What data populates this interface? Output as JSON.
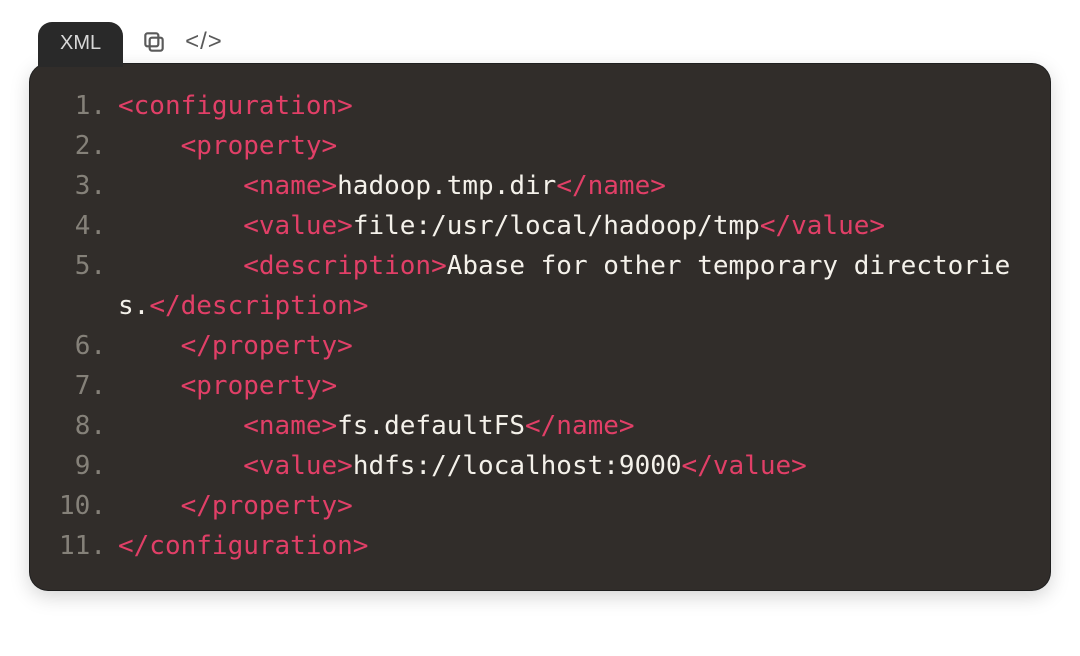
{
  "tab": {
    "label": "XML"
  },
  "icons": {
    "copy": "copy-icon",
    "code": "</>"
  },
  "lines": [
    {
      "n": "1.",
      "segs": [
        {
          "c": "tag",
          "t": "<configuration>"
        }
      ]
    },
    {
      "n": "2.",
      "segs": [
        {
          "c": "txt",
          "t": "    "
        },
        {
          "c": "tag",
          "t": "<property>"
        }
      ]
    },
    {
      "n": "3.",
      "segs": [
        {
          "c": "txt",
          "t": "        "
        },
        {
          "c": "tag",
          "t": "<name>"
        },
        {
          "c": "txt",
          "t": "hadoop.tmp.dir"
        },
        {
          "c": "tag",
          "t": "</name>"
        }
      ]
    },
    {
      "n": "4.",
      "segs": [
        {
          "c": "txt",
          "t": "        "
        },
        {
          "c": "tag",
          "t": "<value>"
        },
        {
          "c": "txt",
          "t": "file:/usr/local/hadoop/tmp"
        },
        {
          "c": "tag",
          "t": "</value>"
        }
      ]
    },
    {
      "n": "5.",
      "segs": [
        {
          "c": "txt",
          "t": "        "
        },
        {
          "c": "tag",
          "t": "<description>"
        },
        {
          "c": "txt",
          "t": "Abase for other temporary directories."
        },
        {
          "c": "tag",
          "t": "</description>"
        }
      ]
    },
    {
      "n": "6.",
      "segs": [
        {
          "c": "txt",
          "t": "    "
        },
        {
          "c": "tag",
          "t": "</property>"
        }
      ]
    },
    {
      "n": "7.",
      "segs": [
        {
          "c": "txt",
          "t": "    "
        },
        {
          "c": "tag",
          "t": "<property>"
        }
      ]
    },
    {
      "n": "8.",
      "segs": [
        {
          "c": "txt",
          "t": "        "
        },
        {
          "c": "tag",
          "t": "<name>"
        },
        {
          "c": "txt",
          "t": "fs.defaultFS"
        },
        {
          "c": "tag",
          "t": "</name>"
        }
      ]
    },
    {
      "n": "9.",
      "segs": [
        {
          "c": "txt",
          "t": "        "
        },
        {
          "c": "tag",
          "t": "<value>"
        },
        {
          "c": "txt",
          "t": "hdfs://localhost:9000"
        },
        {
          "c": "tag",
          "t": "</value>"
        }
      ]
    },
    {
      "n": "10.",
      "segs": [
        {
          "c": "txt",
          "t": "    "
        },
        {
          "c": "tag",
          "t": "</property>"
        }
      ]
    },
    {
      "n": "11.",
      "segs": [
        {
          "c": "tag",
          "t": "</configuration>"
        }
      ]
    }
  ]
}
